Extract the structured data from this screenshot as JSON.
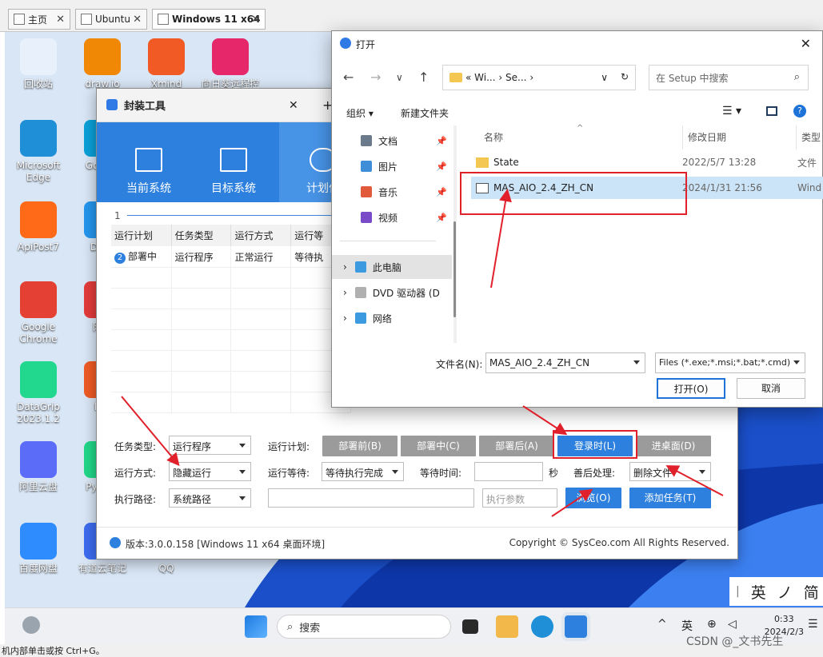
{
  "vm_tabs": [
    {
      "label": "主页"
    },
    {
      "label": "Ubuntu"
    },
    {
      "label": "Windows 11 x64"
    }
  ],
  "desktop_icons": [
    {
      "label": "回收站",
      "color": "#e8f1fb"
    },
    {
      "label": "draw.io",
      "color": "#f08705"
    },
    {
      "label": "Xmind",
      "color": "#f15a24"
    },
    {
      "label": "向日葵远程控",
      "color": "#e6286b"
    },
    {
      "label": "Microsoft Edge",
      "color": "#1f8fd8"
    },
    {
      "label": "GoLa 3",
      "color": "#0aa1d8"
    },
    {
      "label": "ApiPost7",
      "color": "#ff6a19"
    },
    {
      "label": "Dock",
      "color": "#2496ed"
    },
    {
      "label": "Google Chrome",
      "color": "#e44134"
    },
    {
      "label": "网易",
      "color": "#e33b3b"
    },
    {
      "label": "DataGrip 2023.1.2",
      "color": "#22d88f"
    },
    {
      "label": "Pos",
      "color": "#ef5b25"
    },
    {
      "label": "阿里云盘",
      "color": "#5b6cf9"
    },
    {
      "label": "PyCh 2",
      "color": "#21d789"
    },
    {
      "label": "百度网盘",
      "color": "#2f8cff"
    },
    {
      "label": "有道云笔记",
      "color": "#3d6cf0"
    },
    {
      "label": "QQ",
      "color": "#1fa9f4"
    }
  ],
  "packager": {
    "tab_title": "封装工具",
    "nav": [
      {
        "label": "当前系统"
      },
      {
        "label": "目标系统"
      },
      {
        "label": "计划任"
      }
    ],
    "tab_number": "1",
    "table": {
      "headers": [
        "运行计划",
        "任务类型",
        "运行方式",
        "运行等"
      ],
      "row": {
        "num": "2",
        "plan": "部署中",
        "type": "运行程序",
        "mode": "正常运行",
        "wait": "等待执"
      }
    },
    "form": {
      "task_type_label": "任务类型:",
      "task_type_value": "运行程序",
      "run_mode_label": "运行方式:",
      "run_mode_value": "隐藏运行",
      "exec_path_label": "执行路径:",
      "exec_path_value": "系统路径",
      "run_plan_label": "运行计划:",
      "run_wait_label": "运行等待:",
      "run_wait_value": "等待执行完成",
      "wait_time_label": "等待时间:",
      "seconds_unit": "秒",
      "cleanup_label": "善后处理:",
      "cleanup_value": "删除文件",
      "params_placeholder": "执行参数"
    },
    "plan_buttons": [
      "部署前(B)",
      "部署中(C)",
      "部署后(A)",
      "登录时(L)",
      "进桌面(D)"
    ],
    "browse_button": "浏览(O)",
    "add_task_button": "添加任务(T)",
    "version": "版本:3.0.0.158 [Windows 11 x64 桌面环境]",
    "copyright": "Copyright © SysCeo.com All Rights Reserved."
  },
  "dialog": {
    "title": "打开",
    "address": [
      "«",
      "Wi...",
      "›",
      "Se...",
      "›"
    ],
    "search_placeholder": "在 Setup 中搜索",
    "organize": "组织 ▾",
    "new_folder": "新建文件夹",
    "nav_items": [
      {
        "label": "文档",
        "color": "#6b7b8c"
      },
      {
        "label": "图片",
        "color": "#3f8fd8"
      },
      {
        "label": "音乐",
        "color": "#e25a3c"
      },
      {
        "label": "视频",
        "color": "#7a4bc9"
      },
      {
        "label": "此电脑",
        "color": "#3b9ae0"
      },
      {
        "label": "DVD 驱动器 (D",
        "color": "#b0b0b0"
      },
      {
        "label": "网络",
        "color": "#3b9ae0"
      }
    ],
    "columns": [
      "名称",
      "修改日期",
      "类型"
    ],
    "files": [
      {
        "name": "State",
        "date": "2022/5/7 13:28",
        "type": "文件",
        "kind": "folder"
      },
      {
        "name": "MAS_AIO_2.4_ZH_CN",
        "date": "2024/1/31 21:56",
        "type": "Wind",
        "kind": "script"
      }
    ],
    "filename_label": "文件名(N):",
    "filename_value": "MAS_AIO_2.4_ZH_CN",
    "filter_value": "Files (*.exe;*.msi;*.bat;*.cmd)",
    "open_button": "打开(O)",
    "cancel_button": "取消"
  },
  "taskbar": {
    "search_label": "搜索",
    "ime": "英",
    "time": "0:33",
    "date": "2024/2/3"
  },
  "ime_bar": [
    "英",
    "ノ",
    "简"
  ],
  "status_text": "机内部单击或按 Ctrl+G。",
  "watermark": "CSDN @_文书先生"
}
